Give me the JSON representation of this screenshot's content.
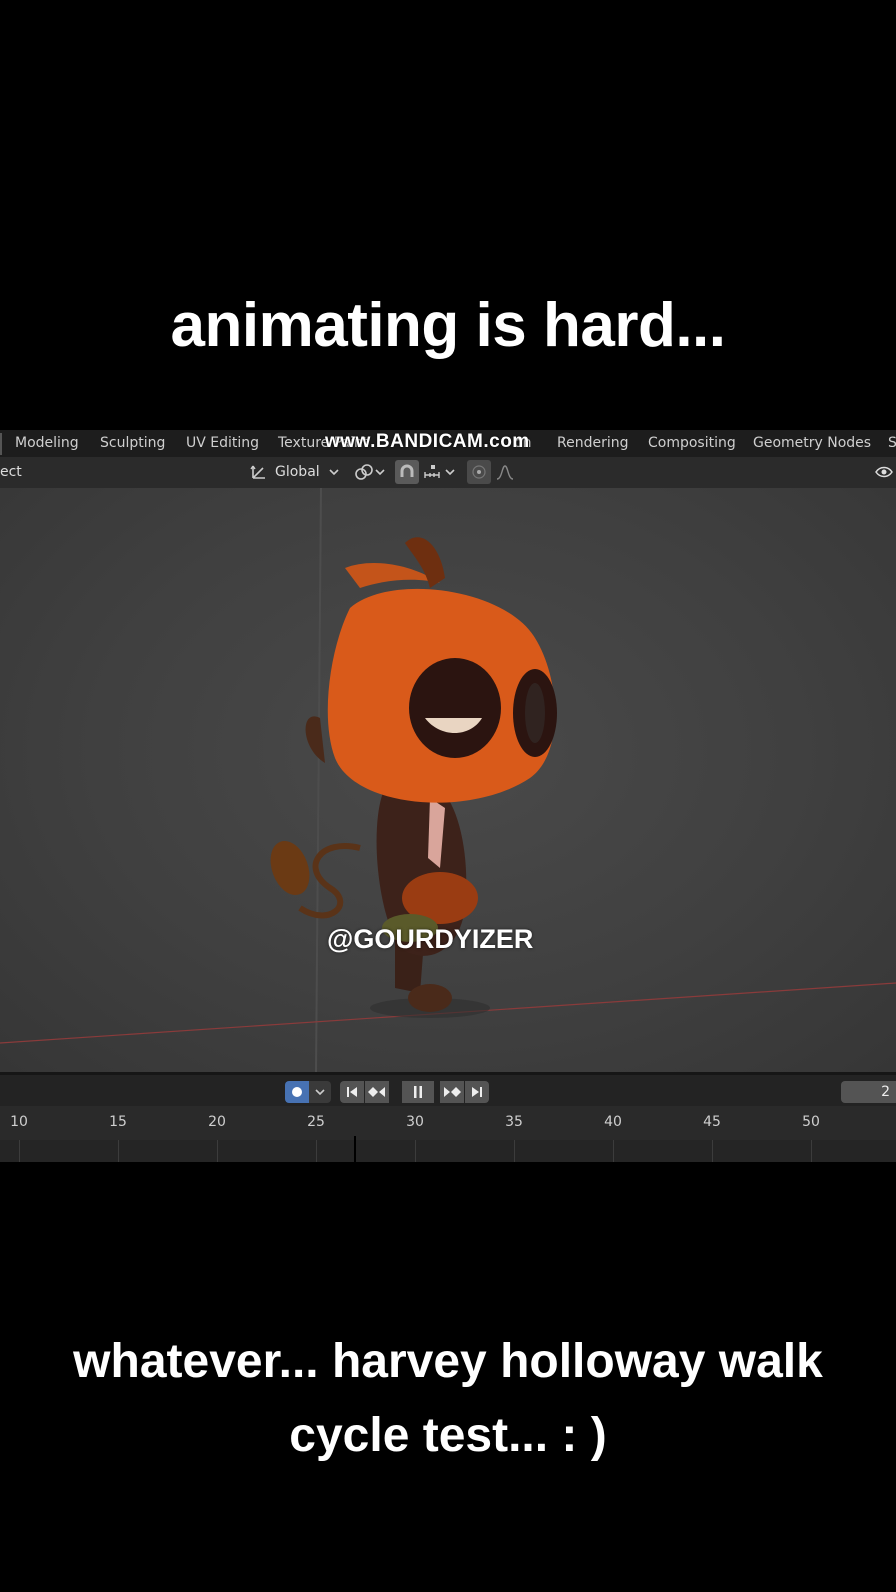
{
  "captions": {
    "top": "animating is hard...",
    "bottom": "whatever... harvey holloway walk cycle test... : )"
  },
  "watermark": "www.BANDICAM.com",
  "overlay_handle": "@GOURDYIZER",
  "workspace_tabs": [
    "Modeling",
    "Sculpting",
    "UV Editing",
    "Texture Paint",
    "on",
    "Rendering",
    "Compositing",
    "Geometry Nodes",
    "S"
  ],
  "header": {
    "left_text": "ect",
    "orientation": "Global"
  },
  "timeline": {
    "current_frame": "2",
    "ticks": [
      "10",
      "15",
      "20",
      "25",
      "30",
      "35",
      "40",
      "45",
      "50"
    ],
    "playhead_frame": 27
  },
  "icons": [
    "transform-orientation-icon",
    "chevron-down-icon",
    "pivot-link-icon",
    "snap-magnet-icon",
    "snap-increment-icon",
    "proportional-edit-icon",
    "falloff-curve-icon",
    "visibility-eye-icon",
    "record-icon",
    "jump-start-icon",
    "prev-keyframe-icon",
    "pause-icon",
    "next-keyframe-icon",
    "jump-end-icon"
  ],
  "colors": {
    "record_button": "#4772b3",
    "character_orange": "#e0621c",
    "background": "#000000"
  }
}
